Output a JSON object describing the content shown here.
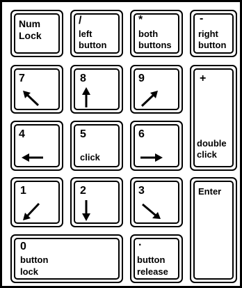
{
  "keys": {
    "numlock": {
      "line1": "Num",
      "line2": "Lock"
    },
    "divide": {
      "symbol": "/",
      "line1": "left",
      "line2": "button"
    },
    "multiply": {
      "symbol": "*",
      "line1": "both",
      "line2": "buttons"
    },
    "minus": {
      "symbol": "-",
      "line1": "right",
      "line2": "button"
    },
    "k7": {
      "digit": "7",
      "arrow": "up-left-arrow"
    },
    "k8": {
      "digit": "8",
      "arrow": "up-arrow"
    },
    "k9": {
      "digit": "9",
      "arrow": "up-right-arrow"
    },
    "plus": {
      "symbol": "+",
      "line1": "double",
      "line2": "click"
    },
    "k4": {
      "digit": "4",
      "arrow": "left-arrow"
    },
    "k5": {
      "digit": "5",
      "line1": "click"
    },
    "k6": {
      "digit": "6",
      "arrow": "right-arrow"
    },
    "k1": {
      "digit": "1",
      "arrow": "down-left-arrow"
    },
    "k2": {
      "digit": "2",
      "arrow": "down-arrow"
    },
    "k3": {
      "digit": "3",
      "arrow": "down-right-arrow"
    },
    "enter": {
      "line1": "Enter"
    },
    "k0": {
      "digit": "0",
      "line1": "button",
      "line2": "lock"
    },
    "decimal": {
      "symbol": ".",
      "line1": "button",
      "line2": "release"
    }
  }
}
